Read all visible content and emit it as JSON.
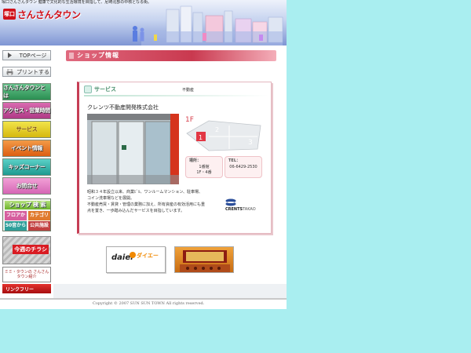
{
  "header": {
    "tagline": "塚口さんさんタウン 健康で文化的な生活環境を目指して、尼崎北部の中核となる街。",
    "logo_mark": "塚口",
    "logo_text": "さんさんタウン"
  },
  "sidebar": {
    "top_button": "TOPページ",
    "print_button": "プリントする",
    "nav": [
      {
        "label": "さんさんタウンとは"
      },
      {
        "label": "アクセス・営業時間"
      },
      {
        "label": "サービス"
      },
      {
        "label": "イベント情報"
      },
      {
        "label": "キッズコーナー"
      },
      {
        "label": "お問合せ"
      }
    ],
    "shop_search": {
      "title": "ショップ 検 索",
      "items": [
        "フロアから",
        "カテゴリから",
        "50音から",
        "公共施設から"
      ]
    },
    "banner_rakuen": "今週のチラシ",
    "banner_sansan": "ミミ・タウンの さんさんタウン紹介",
    "banner_link": "リンクフリー"
  },
  "main": {
    "page_title": "ショップ情報",
    "card": {
      "category": "サービス",
      "category_tag": "不動産",
      "shop_name": "クレンツ不動産開発株式会社",
      "floor_label": "1F",
      "place_label": "場所：",
      "place_value_1": "1番館",
      "place_value_2": "1F・4番",
      "tel_label": "TEL：",
      "tel_value": "06-6429-2530",
      "description": [
        "昭和３４年設立以来、商業ﾋﾞﾙ、ワンルームマンション、駐車場、",
        "コイン洗車場などを展開。",
        "不動産売買・賃貸・管理の業務に加え、所有資産の有効活用にも重",
        "点を置き、一歩踏み込んだサービスを目指しています。"
      ],
      "logo_text_bold": "CRENTS",
      "logo_text_light": "TAKAO"
    },
    "banners": {
      "daiei_mark": "daiei",
      "daiei_name": "ダイエー"
    }
  },
  "footer": {
    "copyright": "Copyright © 2007 SUN SUN TOWN All rights reserved."
  },
  "colors": {
    "background": "#a9eef0",
    "accent": "#c63e55",
    "brand_red": "#d0111b"
  }
}
